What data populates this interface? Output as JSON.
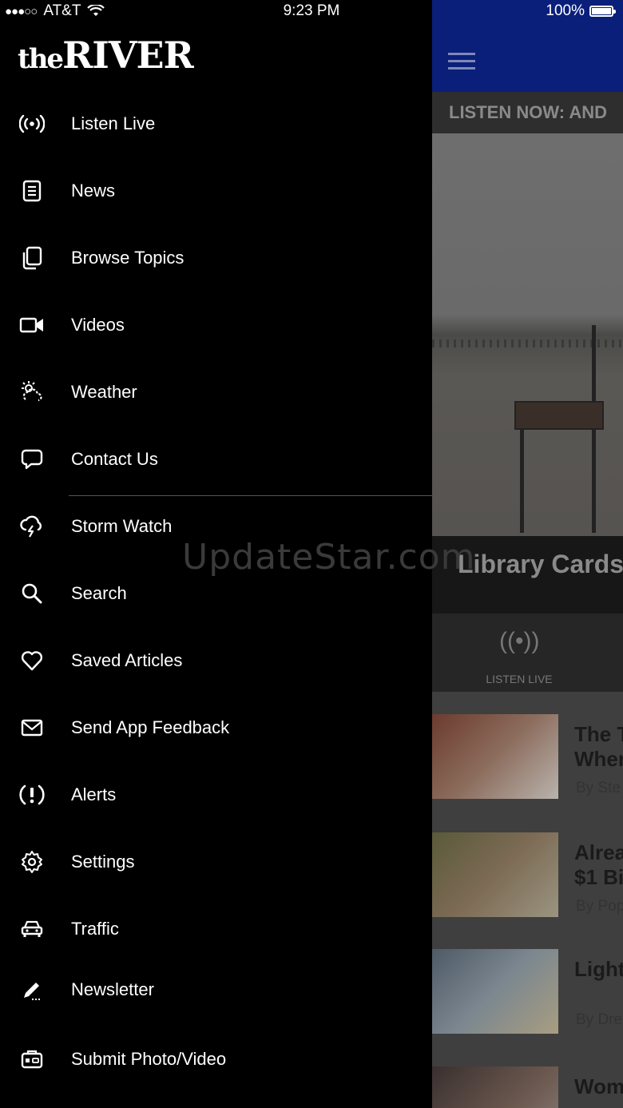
{
  "status_bar": {
    "carrier": "AT&T",
    "time": "9:23 PM",
    "battery": "100%"
  },
  "drawer": {
    "logo_the": "the",
    "logo_river": "RIVER",
    "items": [
      {
        "label": "Listen Live",
        "icon": "broadcast-icon"
      },
      {
        "label": "News",
        "icon": "document-icon"
      },
      {
        "label": "Browse Topics",
        "icon": "copy-icon"
      },
      {
        "label": "Videos",
        "icon": "video-camera-icon"
      },
      {
        "label": "Weather",
        "icon": "weather-icon"
      },
      {
        "label": "Contact Us",
        "icon": "chat-bubble-icon"
      },
      {
        "label": "Storm Watch",
        "icon": "storm-icon"
      },
      {
        "label": "Search",
        "icon": "search-icon"
      },
      {
        "label": "Saved Articles",
        "icon": "heart-icon"
      },
      {
        "label": "Send App Feedback",
        "icon": "envelope-icon"
      },
      {
        "label": "Alerts",
        "icon": "alert-icon"
      },
      {
        "label": "Settings",
        "icon": "gear-icon"
      },
      {
        "label": "Traffic",
        "icon": "car-icon"
      },
      {
        "label": "Newsletter",
        "icon": "pencil-icon"
      },
      {
        "label": "Submit Photo/Video",
        "icon": "camera-icon"
      }
    ]
  },
  "watermark": "UpdateStar.com",
  "app": {
    "ticker": "LISTEN NOW: AND",
    "headline": "Library Cards",
    "listen_live_label": "LISTEN LIVE",
    "articles": [
      {
        "title_line1": "The T",
        "title_line2": "When",
        "byline": "By Ste"
      },
      {
        "title_line1": "Alrea",
        "title_line2": "$1 Bi",
        "byline": "By Pop"
      },
      {
        "title_line1": "Light",
        "title_line2": "",
        "byline": "By Dre"
      },
      {
        "title_line1": "Wom",
        "title_line2": "",
        "byline": ""
      }
    ]
  }
}
